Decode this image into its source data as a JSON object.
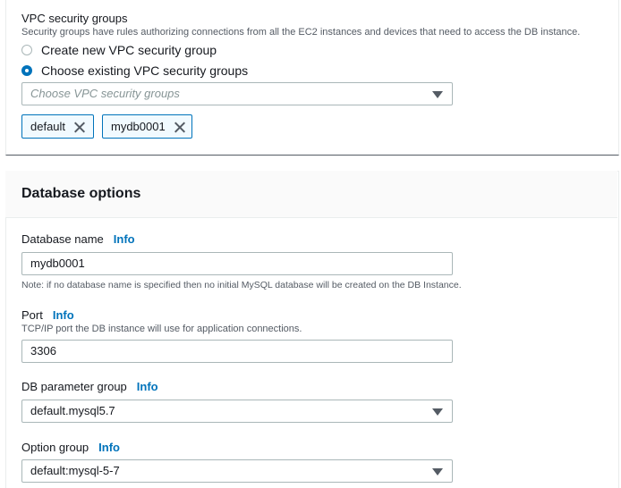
{
  "vpc_security": {
    "label": "VPC security groups",
    "description": "Security groups have rules authorizing connections from all the EC2 instances and devices that need to access the DB instance.",
    "options": [
      {
        "label": "Create new VPC security group",
        "selected": false
      },
      {
        "label": "Choose existing VPC security groups",
        "selected": true
      }
    ],
    "select_placeholder": "Choose VPC security groups",
    "tokens": [
      "default",
      "mydb0001"
    ]
  },
  "database_options": {
    "title": "Database options",
    "info_label": "Info",
    "db_name": {
      "label": "Database name",
      "value": "mydb0001",
      "note": "Note: if no database name is specified then no initial MySQL database will be created on the DB Instance."
    },
    "port": {
      "label": "Port",
      "description": "TCP/IP port the DB instance will use for application connections.",
      "value": "3306"
    },
    "db_parameter_group": {
      "label": "DB parameter group",
      "value": "default.mysql5.7"
    },
    "option_group": {
      "label": "Option group",
      "value": "default:mysql-5-7"
    }
  },
  "colors": {
    "accent": "#0073bb",
    "token_bg": "#f1faff",
    "border": "#aab7b8"
  }
}
